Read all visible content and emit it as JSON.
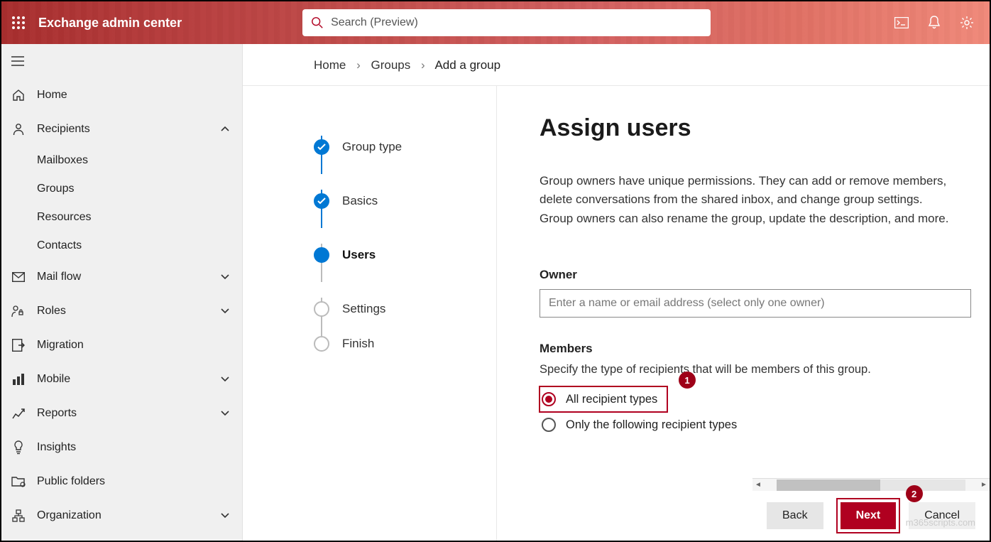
{
  "header": {
    "brand": "Exchange admin center",
    "search_placeholder": "Search (Preview)"
  },
  "sidebar": {
    "home": "Home",
    "recipients": {
      "label": "Recipients",
      "expanded": true,
      "children": [
        "Mailboxes",
        "Groups",
        "Resources",
        "Contacts"
      ]
    },
    "items": [
      {
        "label": "Mail flow",
        "icon": "mail",
        "expandable": true
      },
      {
        "label": "Roles",
        "icon": "person-key",
        "expandable": true
      },
      {
        "label": "Migration",
        "icon": "migration",
        "expandable": false
      },
      {
        "label": "Mobile",
        "icon": "mobile",
        "expandable": true
      },
      {
        "label": "Reports",
        "icon": "chart",
        "expandable": true
      },
      {
        "label": "Insights",
        "icon": "bulb",
        "expandable": false
      },
      {
        "label": "Public folders",
        "icon": "folder",
        "expandable": false
      },
      {
        "label": "Organization",
        "icon": "org",
        "expandable": true
      }
    ]
  },
  "breadcrumb": [
    "Home",
    "Groups",
    "Add a group"
  ],
  "wizard_steps": [
    {
      "label": "Group type",
      "state": "completed"
    },
    {
      "label": "Basics",
      "state": "completed"
    },
    {
      "label": "Users",
      "state": "current"
    },
    {
      "label": "Settings",
      "state": "pending"
    },
    {
      "label": "Finish",
      "state": "pending"
    }
  ],
  "form": {
    "title": "Assign users",
    "description": "Group owners have unique permissions. They can add or remove members, delete conversations from the shared inbox, and change group settings. Group owners can also rename the group, update the description, and more.",
    "owner_label": "Owner",
    "owner_placeholder": "Enter a name or email address (select only one owner)",
    "members_label": "Members",
    "members_desc": "Specify the type of recipients that will be members of this group.",
    "radios": [
      {
        "label": "All recipient types",
        "selected": true
      },
      {
        "label": "Only the following recipient types",
        "selected": false
      }
    ]
  },
  "buttons": {
    "back": "Back",
    "next": "Next",
    "cancel": "Cancel"
  },
  "annotations": {
    "1": "1",
    "2": "2"
  },
  "watermark": "m365scripts.com"
}
